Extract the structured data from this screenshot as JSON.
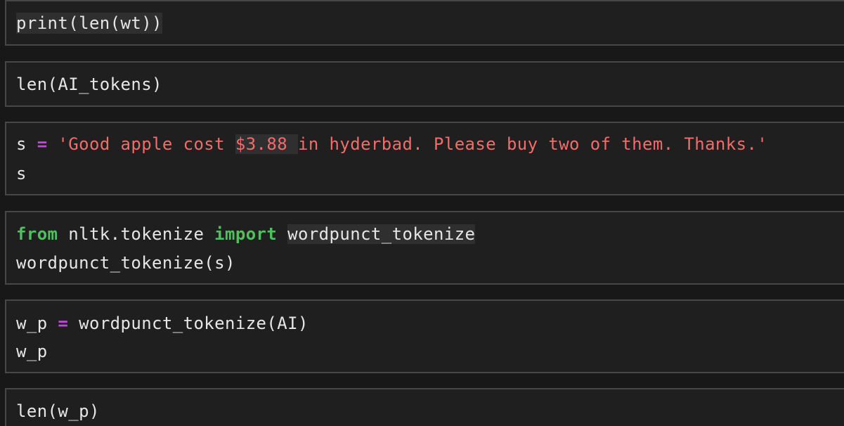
{
  "cells": [
    {
      "lines": [
        {
          "segments": [
            {
              "text": "print(len(wt))"
            }
          ]
        }
      ]
    },
    {
      "lines": [
        {
          "segments": [
            {
              "text": "len(AI_tokens)"
            }
          ]
        }
      ]
    },
    {
      "lines": [
        {
          "segments": [
            {
              "text": "s "
            },
            {
              "text": "="
            },
            {
              "text": " "
            },
            {
              "text": "'Good apple cost "
            },
            {
              "text": "$3.88 "
            },
            {
              "text": "in hyderbad. Please buy two of them. Thanks.'"
            }
          ]
        },
        {
          "segments": [
            {
              "text": "s"
            }
          ]
        }
      ]
    },
    {
      "lines": [
        {
          "segments": [
            {
              "text": "from"
            },
            {
              "text": " nltk.tokenize "
            },
            {
              "text": "import"
            },
            {
              "text": " "
            },
            {
              "text": "wordpunct_tokenize"
            }
          ]
        },
        {
          "segments": [
            {
              "text": "wordpunct_tokenize(s)"
            }
          ]
        }
      ]
    },
    {
      "lines": [
        {
          "segments": [
            {
              "text": "w_p "
            },
            {
              "text": "="
            },
            {
              "text": " wordpunct_tokenize(AI)"
            }
          ]
        },
        {
          "segments": [
            {
              "text": "w_p"
            }
          ]
        }
      ]
    },
    {
      "lines": [
        {
          "segments": [
            {
              "text": "len(w_p)"
            }
          ]
        }
      ]
    }
  ],
  "colors": {
    "background": "#181818",
    "cell_background": "#1f1f1f",
    "cell_border": "#474747",
    "default_text": "#e6e6e6",
    "operator": "#c04bd8",
    "keyword": "#4fbf5f",
    "string": "#f26c6c"
  }
}
